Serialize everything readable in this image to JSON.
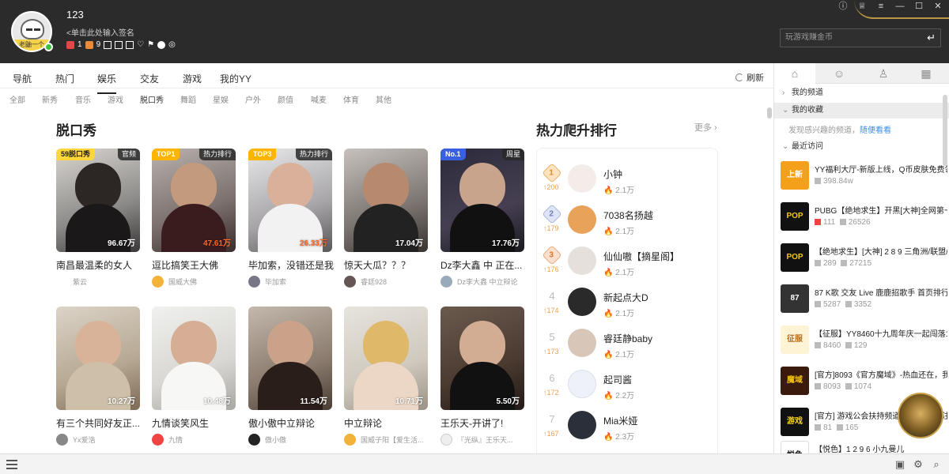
{
  "user": {
    "name": "123",
    "signature": "<单击此处输入签名",
    "avatar_caption": "老鼬一个",
    "badge_count_1": "1",
    "badge_count_2": "9"
  },
  "game_search": {
    "placeholder": "玩游戏赚金币"
  },
  "tabs": [
    "导航",
    "热门",
    "娱乐",
    "交友",
    "游戏",
    "我的YY"
  ],
  "active_tab": "娱乐",
  "refresh_label": "刷新",
  "subtabs": [
    "全部",
    "新秀",
    "音乐",
    "游戏",
    "脱口秀",
    "舞蹈",
    "星娱",
    "户外",
    "颜值",
    "喊麦",
    "体育",
    "其他"
  ],
  "active_subtab": "脱口秀",
  "section_title": "脱口秀",
  "cards": [
    {
      "title": "南昌最温柔的女人",
      "owner": "紫云",
      "count": "96.67万",
      "badge": "59脱口秀",
      "badge_right": "官频",
      "hot": false
    },
    {
      "title": "逗比搞笑王大佛",
      "owner": "国威大佛",
      "count": "47.61万",
      "badge": "TOP1",
      "badge_right": "热力排行",
      "hot": true
    },
    {
      "title": "毕加索，没错还是我",
      "owner": "毕加索",
      "count": "26.33万",
      "badge": "TOP3",
      "badge_right": "热力排行",
      "hot": true
    },
    {
      "title": "惊天大瓜？？？",
      "owner": "睿廷928",
      "count": "17.04万",
      "badge": "",
      "badge_right": "",
      "hot": false
    },
    {
      "title": "Dz李大鑫 中 正在...",
      "owner": "Dz李大鑫 中立辩论",
      "count": "17.76万",
      "badge": "No.1",
      "badge_right": "周星",
      "hot": false
    },
    {
      "title": "有三个共同好友正...",
      "owner": "Yx爱浩",
      "count": "10.27万",
      "badge": "",
      "badge_right": "",
      "hot": false
    },
    {
      "title": "九情谈笑风生",
      "owner": "九情",
      "count": "10.48万",
      "badge": "",
      "badge_right": "",
      "hot": false
    },
    {
      "title": "傲小傲中立辩论",
      "owner": "傲小傲",
      "count": "11.54万",
      "badge": "",
      "badge_right": "",
      "hot": false
    },
    {
      "title": "中立辩论",
      "owner": "国威子阳【爱生活...",
      "count": "10.71万",
      "badge": "",
      "badge_right": "",
      "hot": false
    },
    {
      "title": "王乐天-开讲了!",
      "owner": "『光纵』王乐天...",
      "count": "5.50万",
      "badge": "",
      "badge_right": "",
      "hot": false
    }
  ],
  "rank": {
    "title": "热力爬升排行",
    "more": "更多 ›",
    "items": [
      {
        "rank": "1",
        "rise": "↑200",
        "name": "小钟",
        "heat": "2.1万"
      },
      {
        "rank": "2",
        "rise": "↑179",
        "name": "7038名扬越",
        "heat": "2.1万"
      },
      {
        "rank": "3",
        "rise": "↑176",
        "name": "仙仙嗷【摘星阁】",
        "heat": "2.1万"
      },
      {
        "rank": "4",
        "rise": "↑174",
        "name": "新起点大D",
        "heat": "2.1万"
      },
      {
        "rank": "5",
        "rise": "↑173",
        "name": "睿廷静baby",
        "heat": "2.1万"
      },
      {
        "rank": "6",
        "rise": "↑172",
        "name": "起司酱",
        "heat": "2.2万"
      },
      {
        "rank": "7",
        "rise": "↑167",
        "name": "Mia米娅",
        "heat": "2.3万"
      }
    ]
  },
  "sidebar": {
    "my_channels": "我的频道",
    "my_favorites": "我的收藏",
    "hint": "发现感兴趣的频道，",
    "hint_link": "随便看看",
    "recent": "最近访问",
    "recent_items": [
      {
        "thumb": "上新",
        "title": "YY福利大厅-新版上线，Q币皮肤免费领",
        "m1": "398.84w",
        "m2": ""
      },
      {
        "thumb": "POP",
        "title": "PUBG【绝地求生】开黑[大神]全网第一",
        "m1": "111",
        "m2": "26526"
      },
      {
        "thumb": "POP",
        "title": "【绝地求生】[大神] 2 8 9 三角洲/联盟/",
        "m1": "289",
        "m2": "27215"
      },
      {
        "thumb": "87",
        "title": "87 K歌 交友 Live 鹿鹿招歌手 首页排行榜",
        "m1": "5287",
        "m2": "3352"
      },
      {
        "thumb": "征服",
        "title": "【征服】YY8460十九周年庆一起闯落19",
        "m1": "8460",
        "m2": "129"
      },
      {
        "thumb": "魔域",
        "title": "[官方]8093《官方魔域》-热血还在，我",
        "m1": "8093",
        "m2": "1074"
      },
      {
        "thumb": "游戏",
        "title": "[官方] 游戏公会扶持频道 最新讯息关注",
        "m1": "81",
        "m2": "165"
      },
      {
        "thumb": "悦色",
        "title": "【悦色】1 2 9 6 小九曼儿",
        "m1": "1296",
        "m2": "5290"
      }
    ]
  }
}
